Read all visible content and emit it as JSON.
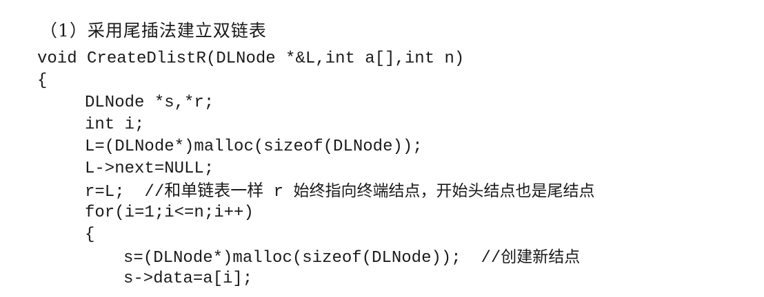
{
  "heading": "（1）采用尾插法建立双链表",
  "code": {
    "line1": "void CreateDlistR(DLNode *&L,int a[],int n)",
    "line2": "{",
    "line3": "DLNode *s,*r;",
    "line4": "int i;",
    "line5": "L=(DLNode*)malloc(sizeof(DLNode));",
    "line6": "L->next=NULL;",
    "line7_code": "r=L;  //和单链表一样 r ",
    "line7_comment": "始终指向终端结点，开始头结点也是尾结点",
    "line8": "for(i=1;i<=n;i++)",
    "line9": "{",
    "line10_code": "s=(DLNode*)malloc(sizeof(DLNode));  //",
    "line10_comment": "创建新结点",
    "line11": "s->data=a[i];"
  }
}
